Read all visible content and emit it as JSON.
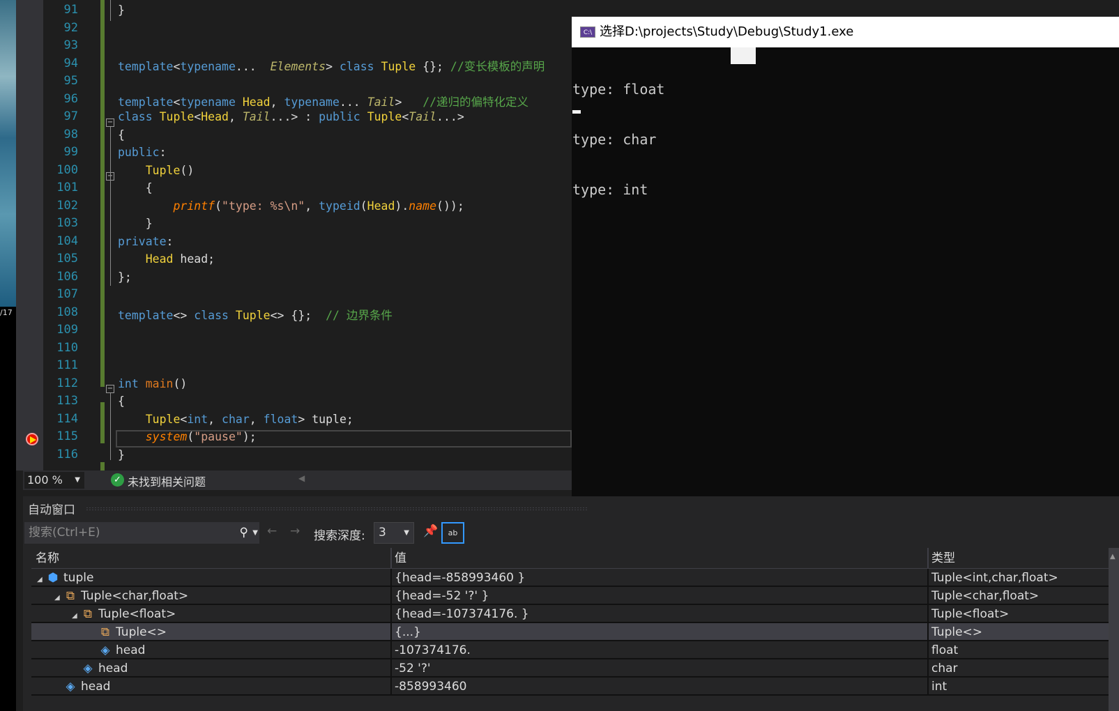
{
  "desktop": {
    "text": "/17"
  },
  "editor": {
    "lines": [
      {
        "n": "91",
        "t": [
          [
            "pl",
            "}"
          ]
        ]
      },
      {
        "n": "92",
        "t": []
      },
      {
        "n": "93",
        "t": []
      },
      {
        "n": "94",
        "t": [
          [
            "kw",
            "template"
          ],
          [
            "pl",
            "<"
          ],
          [
            "kw",
            "typename"
          ],
          [
            "pl",
            "...  "
          ],
          [
            "tp",
            "Elements"
          ],
          [
            "pl",
            "> "
          ],
          [
            "kw",
            "class "
          ],
          [
            "ty",
            "Tuple"
          ],
          [
            "pl",
            " {}; "
          ],
          [
            "cm",
            "//变长模板的声明"
          ]
        ]
      },
      {
        "n": "95",
        "t": []
      },
      {
        "n": "96",
        "t": [
          [
            "kw",
            "template"
          ],
          [
            "pl",
            "<"
          ],
          [
            "kw",
            "typename "
          ],
          [
            "ty",
            "Head"
          ],
          [
            "pl",
            ", "
          ],
          [
            "kw",
            "typename"
          ],
          [
            "pl",
            "... "
          ],
          [
            "tp",
            "Tail"
          ],
          [
            "pl",
            ">   "
          ],
          [
            "cm",
            "//递归的偏特化定义"
          ]
        ]
      },
      {
        "n": "97",
        "t": [
          [
            "kw",
            "class "
          ],
          [
            "ty",
            "Tuple"
          ],
          [
            "pl",
            "<"
          ],
          [
            "ty",
            "Head"
          ],
          [
            "pl",
            ", "
          ],
          [
            "tp",
            "Tail"
          ],
          [
            "pl",
            "...> : "
          ],
          [
            "kw",
            "public "
          ],
          [
            "ty",
            "Tuple"
          ],
          [
            "pl",
            "<"
          ],
          [
            "tp",
            "Tail"
          ],
          [
            "pl",
            "...>"
          ]
        ]
      },
      {
        "n": "98",
        "t": [
          [
            "pl",
            "{"
          ]
        ]
      },
      {
        "n": "99",
        "t": [
          [
            "kw",
            "public"
          ],
          [
            "pl",
            ":"
          ]
        ]
      },
      {
        "n": "100",
        "t": [
          [
            "pl",
            "    "
          ],
          [
            "ty",
            "Tuple"
          ],
          [
            "pl",
            "()"
          ]
        ]
      },
      {
        "n": "101",
        "t": [
          [
            "pl",
            "    {"
          ]
        ]
      },
      {
        "n": "102",
        "t": [
          [
            "pl",
            "        "
          ],
          [
            "fn",
            "printf"
          ],
          [
            "pl",
            "("
          ],
          [
            "st",
            "\"type: %s\\n\""
          ],
          [
            "pl",
            ", "
          ],
          [
            "kw",
            "typeid"
          ],
          [
            "pl",
            "("
          ],
          [
            "ty",
            "Head"
          ],
          [
            "pl",
            ")."
          ],
          [
            "fn",
            "name"
          ],
          [
            "pl",
            "());"
          ]
        ]
      },
      {
        "n": "103",
        "t": [
          [
            "pl",
            "    }"
          ]
        ]
      },
      {
        "n": "104",
        "t": [
          [
            "kw",
            "private"
          ],
          [
            "pl",
            ":"
          ]
        ]
      },
      {
        "n": "105",
        "t": [
          [
            "pl",
            "    "
          ],
          [
            "ty",
            "Head"
          ],
          [
            "pl",
            " head;"
          ]
        ]
      },
      {
        "n": "106",
        "t": [
          [
            "pl",
            "};"
          ]
        ]
      },
      {
        "n": "107",
        "t": []
      },
      {
        "n": "108",
        "t": [
          [
            "kw",
            "template"
          ],
          [
            "pl",
            "<> "
          ],
          [
            "kw",
            "class "
          ],
          [
            "ty",
            "Tuple"
          ],
          [
            "pl",
            "<> {};  "
          ],
          [
            "cm",
            "// 边界条件"
          ]
        ]
      },
      {
        "n": "109",
        "t": []
      },
      {
        "n": "110",
        "t": []
      },
      {
        "n": "111",
        "t": []
      },
      {
        "n": "112",
        "t": [
          [
            "kw",
            "int "
          ],
          [
            "mn",
            "main"
          ],
          [
            "pl",
            "()"
          ]
        ]
      },
      {
        "n": "113",
        "t": [
          [
            "pl",
            "{"
          ]
        ]
      },
      {
        "n": "114",
        "t": [
          [
            "pl",
            "    "
          ],
          [
            "ty",
            "Tuple"
          ],
          [
            "pl",
            "<"
          ],
          [
            "kw",
            "int"
          ],
          [
            "pl",
            ", "
          ],
          [
            "kw",
            "char"
          ],
          [
            "pl",
            ", "
          ],
          [
            "kw",
            "float"
          ],
          [
            "pl",
            "> tuple;"
          ]
        ]
      },
      {
        "n": "115",
        "t": [
          [
            "pl",
            "    "
          ],
          [
            "fn",
            "system"
          ],
          [
            "pl",
            "("
          ],
          [
            "st",
            "\"pause\""
          ],
          [
            "pl",
            ");"
          ]
        ]
      },
      {
        "n": "116",
        "t": [
          [
            "pl",
            "}"
          ]
        ]
      }
    ]
  },
  "status": {
    "zoom": "100 %",
    "issues": "未找到相关问题"
  },
  "console": {
    "title": "选择D:\\projects\\Study\\Debug\\Study1.exe",
    "icon_text": "C:\\",
    "output": [
      "type: float",
      "type: char",
      "type: int"
    ]
  },
  "autos": {
    "title": "自动窗口",
    "search_placeholder": "搜索(Ctrl+E)",
    "depth_label": "搜索深度:",
    "depth_value": "3",
    "columns": [
      "名称",
      "值",
      "类型"
    ],
    "rows": [
      {
        "name": "tuple",
        "value": "{head=-858993460 }",
        "type": "Tuple<int,char,float>",
        "level": 0,
        "icon": "object-icon",
        "expanded": true
      },
      {
        "name": "Tuple<char,float>",
        "value": "{head=-52 '?' }",
        "type": "Tuple<char,float>",
        "level": 1,
        "icon": "base-class-icon",
        "expanded": true
      },
      {
        "name": "Tuple<float>",
        "value": "{head=-107374176. }",
        "type": "Tuple<float>",
        "level": 2,
        "icon": "base-class-icon",
        "expanded": true
      },
      {
        "name": "Tuple<>",
        "value": "{...}",
        "type": "Tuple<>",
        "level": 3,
        "icon": "base-class-icon",
        "selected": true
      },
      {
        "name": "head",
        "value": "-107374176.",
        "type": "float",
        "level": 3,
        "icon": "private-field-icon"
      },
      {
        "name": "head",
        "value": "-52 '?'",
        "type": "char",
        "level": 2,
        "icon": "private-field-icon"
      },
      {
        "name": "head",
        "value": "-858993460",
        "type": "int",
        "level": 1,
        "icon": "private-field-icon"
      }
    ]
  }
}
